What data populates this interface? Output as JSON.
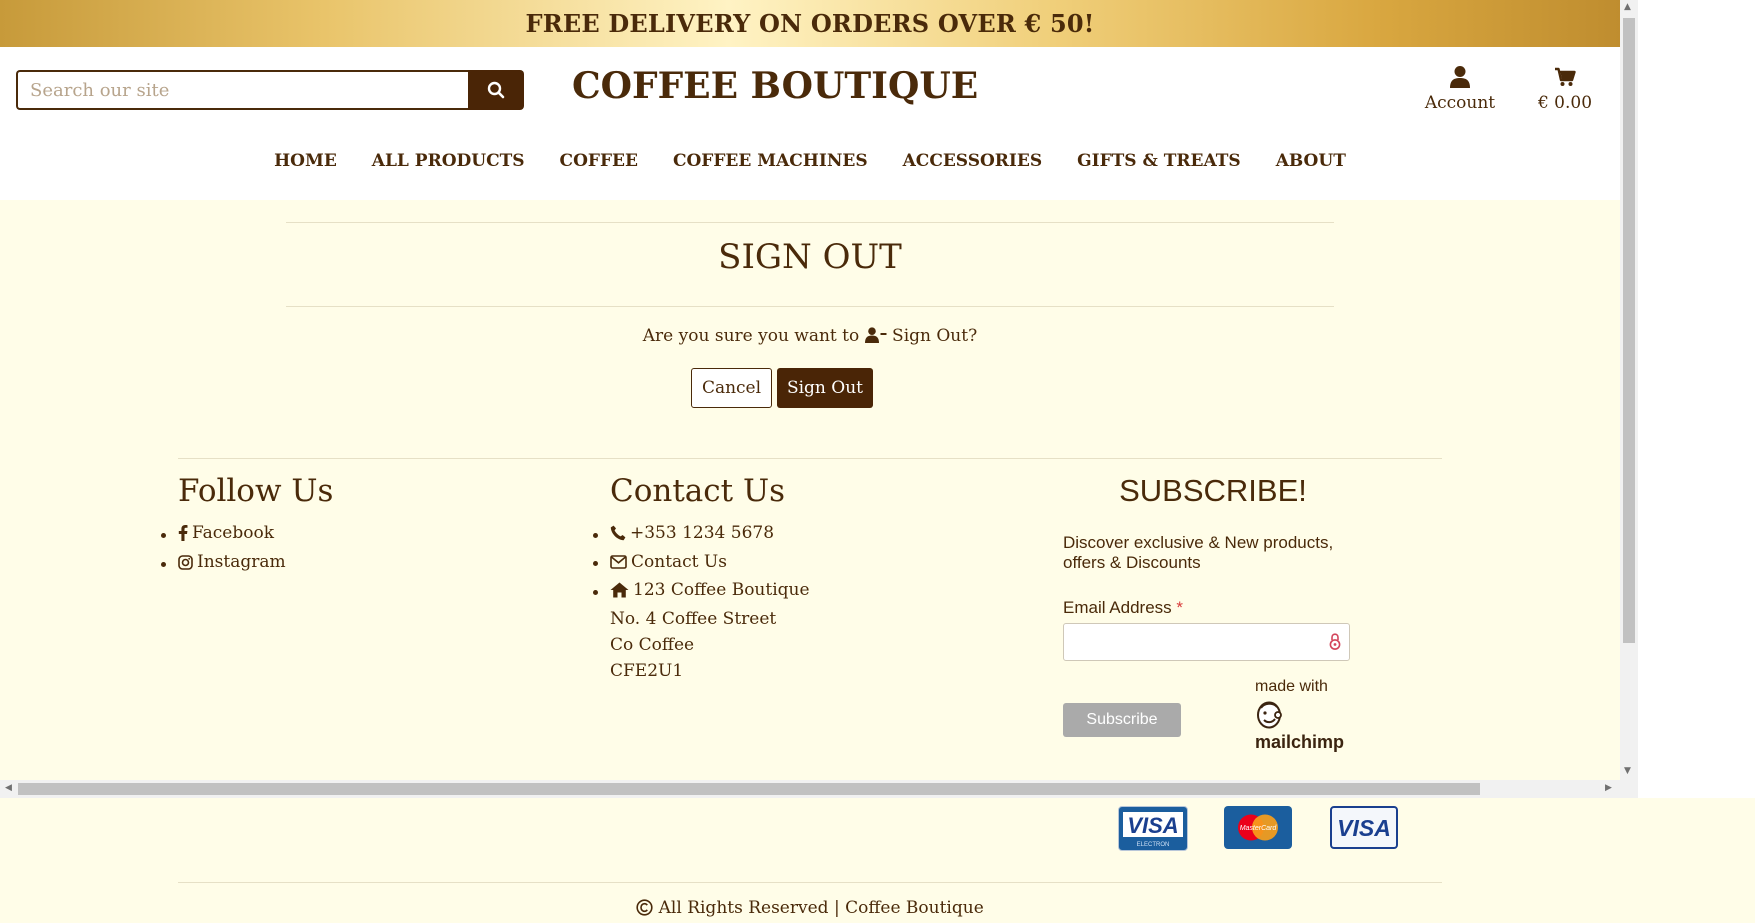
{
  "promo": {
    "text": "FREE DELIVERY ON ORDERS OVER € 50!"
  },
  "header": {
    "search_placeholder": "Search our site",
    "brand": "COFFEE BOUTIQUE",
    "account_label": "Account",
    "cart_total": "€ 0.00"
  },
  "nav": {
    "items": [
      {
        "label": "HOME"
      },
      {
        "label": "ALL PRODUCTS"
      },
      {
        "label": "COFFEE"
      },
      {
        "label": "COFFEE MACHINES"
      },
      {
        "label": "ACCESSORIES"
      },
      {
        "label": "GIFTS & TREATS"
      },
      {
        "label": "ABOUT"
      }
    ]
  },
  "signout": {
    "title": "SIGN OUT",
    "question_prefix": "Are you sure you want to",
    "question_suffix": "Sign Out?",
    "cancel_label": "Cancel",
    "signout_label": "Sign Out"
  },
  "footer": {
    "follow_title": "Follow Us",
    "follow_items": [
      {
        "label": "Facebook",
        "icon": "facebook-icon"
      },
      {
        "label": "Instagram",
        "icon": "instagram-icon"
      }
    ],
    "contact_title": "Contact Us",
    "phone": "+353 1234 5678",
    "contact_link": "Contact Us",
    "address": [
      "123 Coffee Boutique",
      "No. 4 Coffee Street",
      "Co Coffee",
      "CFE2U1"
    ],
    "subscribe": {
      "title": "SUBSCRIBE!",
      "description": "Discover exclusive & New products, offers & Discounts",
      "email_label": "Email Address",
      "required_mark": "*",
      "button_label": "Subscribe",
      "made_with": "made with",
      "brand": "mailchimp"
    },
    "payment_methods": [
      "VISA",
      "MasterCard",
      "VISA"
    ],
    "payment_sub": "ELECTRON",
    "copyright": "All Rights Reserved | Coffee Boutique"
  },
  "colors": {
    "brand_brown": "#4a2506",
    "cream_background": "#fffde8",
    "gold": "#e9c46a"
  }
}
